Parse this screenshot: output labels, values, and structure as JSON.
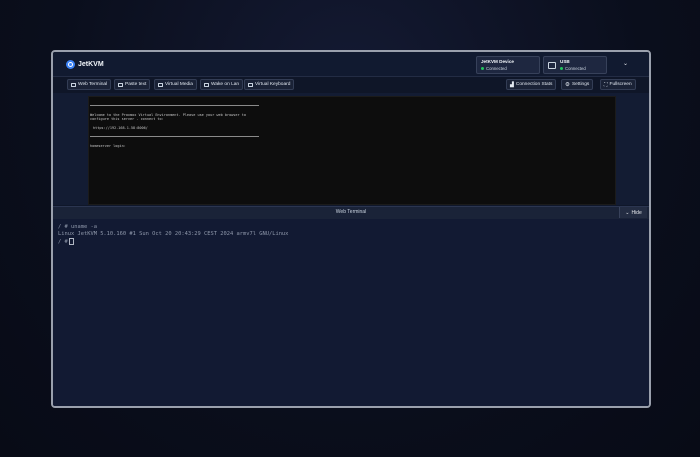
{
  "app": {
    "title": "JetKVM"
  },
  "devices": [
    {
      "title": "JetKVM Device",
      "status": "Connected"
    },
    {
      "title": "USB",
      "status": "Connected"
    }
  ],
  "toolbar": {
    "left": [
      "Web Terminal",
      "Paste text",
      "Virtual Media",
      "Wake on Lan",
      "Virtual Keyboard"
    ],
    "right": [
      "Connection Stats",
      "Settings",
      "Fullscreen"
    ]
  },
  "console": {
    "welcome_1": "Welcome to the Proxmox Virtual Environment. Please use your web browser to",
    "welcome_2": "configure this server - connect to:",
    "url": "https://192.168.1.58:8006/",
    "login": "homeserver login:"
  },
  "web_terminal": {
    "label": "Web Terminal",
    "hide_label": "Hide"
  },
  "terminal": {
    "line1": "/ # uname -a",
    "line2": "Linux JetKVM 5.10.160 #1 Sun Oct 20 20:43:29 CEST 2024 armv7l GNU/Linux",
    "prompt": "/ #"
  },
  "colors": {
    "accent": "#3b82f6",
    "connected": "#22c55e",
    "background": "#0f172a"
  }
}
